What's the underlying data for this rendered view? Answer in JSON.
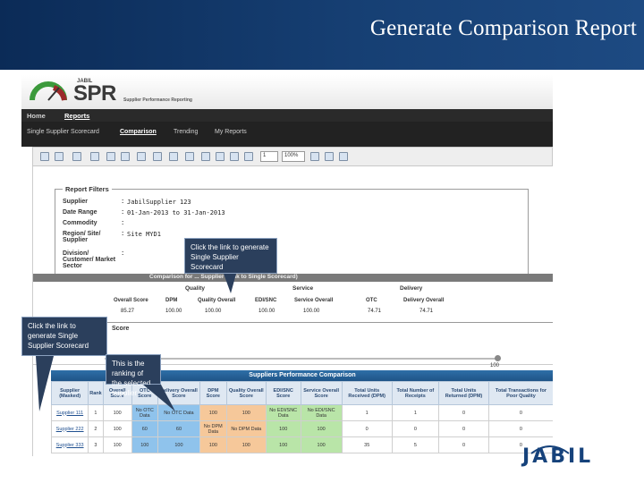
{
  "slide": {
    "title": "Generate Comparison Report"
  },
  "app": {
    "brand_small": "JABIL",
    "brand": "SPR",
    "tagline": "Supplier Performance Reporting",
    "nav": [
      "Home",
      "Reports"
    ],
    "subnav": [
      "Single Supplier Scorecard",
      "Comparison",
      "Trending",
      "My Reports"
    ],
    "toolbar": {
      "zoom": "100%",
      "page": "1"
    }
  },
  "report_filters": {
    "legend": "Report Filters",
    "rows": [
      {
        "label": "Supplier",
        "value": "JabilSupplier 123"
      },
      {
        "label": "Date Range",
        "value": "01-Jan-2013 to 31-Jan-2013"
      },
      {
        "label": "Commodity",
        "value": ""
      },
      {
        "label": "Region/ Site/ Supplier",
        "value": "Site  MYD1"
      },
      {
        "label": "Division/ Customer/ Market Sector",
        "value": ""
      }
    ]
  },
  "comparison_strip": "Comparison for ... Supplier (Link to Single Scorecard)",
  "summary": {
    "groups": [
      "Quality",
      "Service",
      "Delivery"
    ],
    "headers": [
      "Overall Score",
      "DPM",
      "Quality Overall",
      "EDI/SNC",
      "Service Overall",
      "OTC",
      "Delivery Overall"
    ],
    "values": [
      "85.27",
      "100.00",
      "100.00",
      "100.00",
      "100.00",
      "74.71",
      "74.71"
    ],
    "rank_label": "Score",
    "rank_value": "100"
  },
  "comparison": {
    "title": "Suppliers Performance Comparison",
    "headers": [
      "Supplier (Masked)",
      "Rank",
      "Overall Score",
      "OTC Score",
      "Delivery Overall Score",
      "DPM Score",
      "Quality Overall Score",
      "EDI/SNC Score",
      "Service Overall Score",
      "Total Units Received (DPM)",
      "Total Number of Receipts",
      "Total Units Returned (DPM)",
      "Total Transactions for Poor Quality"
    ],
    "rows": [
      [
        "Supplier 111",
        "1",
        "100",
        "No OTC Data",
        "No OTC Data",
        "100",
        "100",
        "No EDI/SNC Data",
        "No EDI/SNC Data",
        "1",
        "1",
        "0",
        "0"
      ],
      [
        "Supplier 222",
        "2",
        "100",
        "60",
        "60",
        "No DPM Data",
        "No DPM Data",
        "100",
        "100",
        "0",
        "0",
        "0",
        "0"
      ],
      [
        "Supplier 333",
        "3",
        "100",
        "100",
        "100",
        "100",
        "100",
        "100",
        "100",
        "35",
        "5",
        "0",
        "0"
      ]
    ]
  },
  "callouts": {
    "a": "Click the link to generate Single Supplier Scorecard",
    "b": "Click the link to generate Single Supplier Scorecard",
    "c": "This is the ranking of the selected supplier"
  },
  "footer_logo": "JABIL"
}
